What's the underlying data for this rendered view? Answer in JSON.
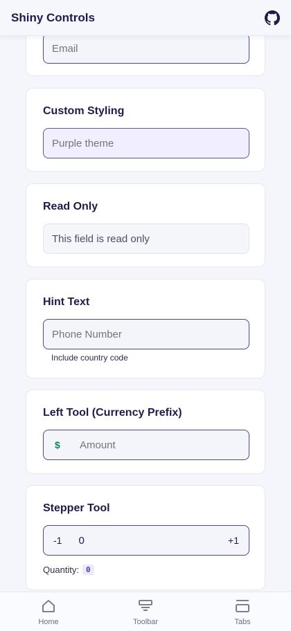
{
  "header": {
    "title": "Shiny Controls",
    "icon": "github-icon"
  },
  "cards": {
    "email": {
      "placeholder": "Email"
    },
    "custom_styling": {
      "title": "Custom Styling",
      "placeholder": "Purple theme"
    },
    "read_only": {
      "title": "Read Only",
      "value": "This field is read only"
    },
    "hint_text": {
      "title": "Hint Text",
      "placeholder": "Phone Number",
      "hint": "Include country code"
    },
    "left_tool": {
      "title": "Left Tool (Currency Prefix)",
      "prefix": "$",
      "placeholder": "Amount"
    },
    "stepper_tool": {
      "title": "Stepper Tool",
      "decrement": "-1",
      "value": "0",
      "increment": "+1",
      "quantity_label": "Quantity:",
      "quantity_value": "0"
    }
  },
  "bottom_nav": {
    "items": [
      {
        "label": "Home",
        "icon": "home-icon"
      },
      {
        "label": "Toolbar",
        "icon": "toolbar-icon"
      },
      {
        "label": "Tabs",
        "icon": "tabs-icon"
      }
    ]
  },
  "colors": {
    "accent": "#1e1b4b",
    "prefix": "#0a8a5a",
    "badge": "#4c3fb3"
  }
}
